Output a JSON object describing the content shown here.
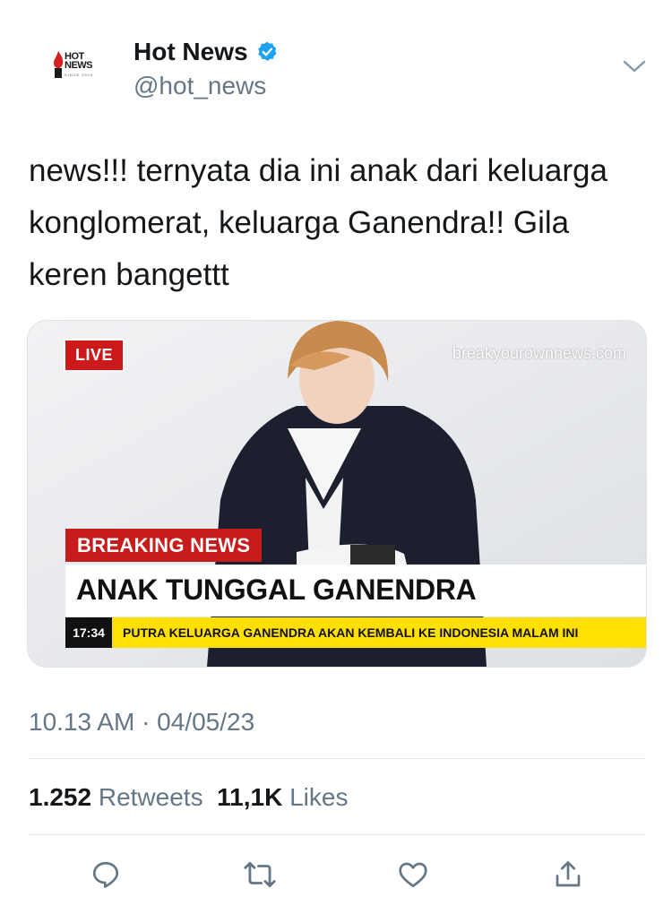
{
  "account": {
    "logo_text_line1": "HOT",
    "logo_text_line2": "NEWS",
    "logo_since": "SINCE 2019",
    "display_name": "Hot News",
    "handle": "@hot_news",
    "verified_icon": "verified-badge-icon",
    "accent_color": "#1da1f2"
  },
  "tweet": {
    "text": "news!!! ternyata dia ini anak dari keluarga konglomerat, keluarga Ganendra!! Gila keren bangettt",
    "timestamp": "10.13 AM · 04/05/23"
  },
  "media": {
    "live_label": "LIVE",
    "watermark": "breakyourownnews.com",
    "breaking_label": "BREAKING NEWS",
    "headline": "ANAK TUNGGAL GANENDRA",
    "ticker_time": "17:34",
    "ticker_text": "PUTRA KELUARGA GANENDRA AKAN KEMBALI KE INDONESIA MALAM INI"
  },
  "stats": {
    "retweets_count": "1.252",
    "retweets_label": "Retweets",
    "likes_count": "11,1K",
    "likes_label": "Likes"
  },
  "actions": [
    {
      "icon": "reply-icon"
    },
    {
      "icon": "retweet-icon"
    },
    {
      "icon": "like-icon"
    },
    {
      "icon": "share-icon"
    }
  ]
}
